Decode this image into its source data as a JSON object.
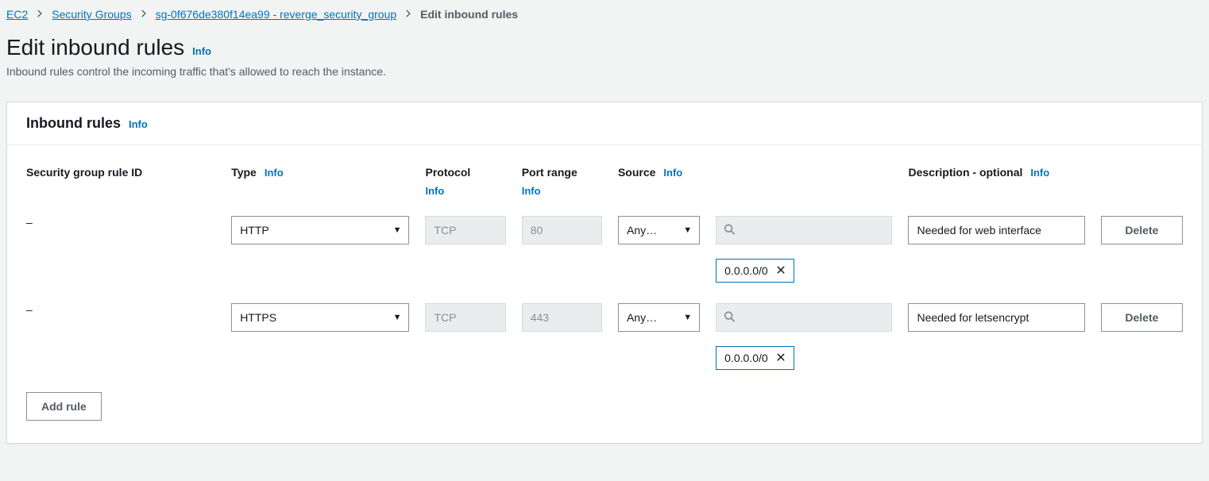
{
  "breadcrumb": {
    "items": [
      {
        "label": "EC2"
      },
      {
        "label": "Security Groups"
      },
      {
        "label": "sg-0f676de380f14ea99 - reverge_security_group"
      }
    ],
    "current": "Edit inbound rules"
  },
  "page": {
    "title": "Edit inbound rules",
    "info": "Info",
    "subtitle": "Inbound rules control the incoming traffic that's allowed to reach the instance."
  },
  "panel": {
    "title": "Inbound rules",
    "info": "Info",
    "headers": {
      "id": "Security group rule ID",
      "type": "Type",
      "type_info": "Info",
      "protocol": "Protocol",
      "protocol_info": "Info",
      "port": "Port range",
      "port_info": "Info",
      "source": "Source",
      "source_info": "Info",
      "description": "Description - optional",
      "description_info": "Info"
    },
    "rules": [
      {
        "id": "–",
        "type": "HTTP",
        "protocol": "TCP",
        "port": "80",
        "source_select": "Any…",
        "cidr": "0.0.0.0/0",
        "description": "Needed for web interface",
        "delete": "Delete"
      },
      {
        "id": "–",
        "type": "HTTPS",
        "protocol": "TCP",
        "port": "443",
        "source_select": "Any…",
        "cidr": "0.0.0.0/0",
        "description": "Needed for letsencrypt",
        "delete": "Delete"
      }
    ],
    "add_rule": "Add rule"
  }
}
